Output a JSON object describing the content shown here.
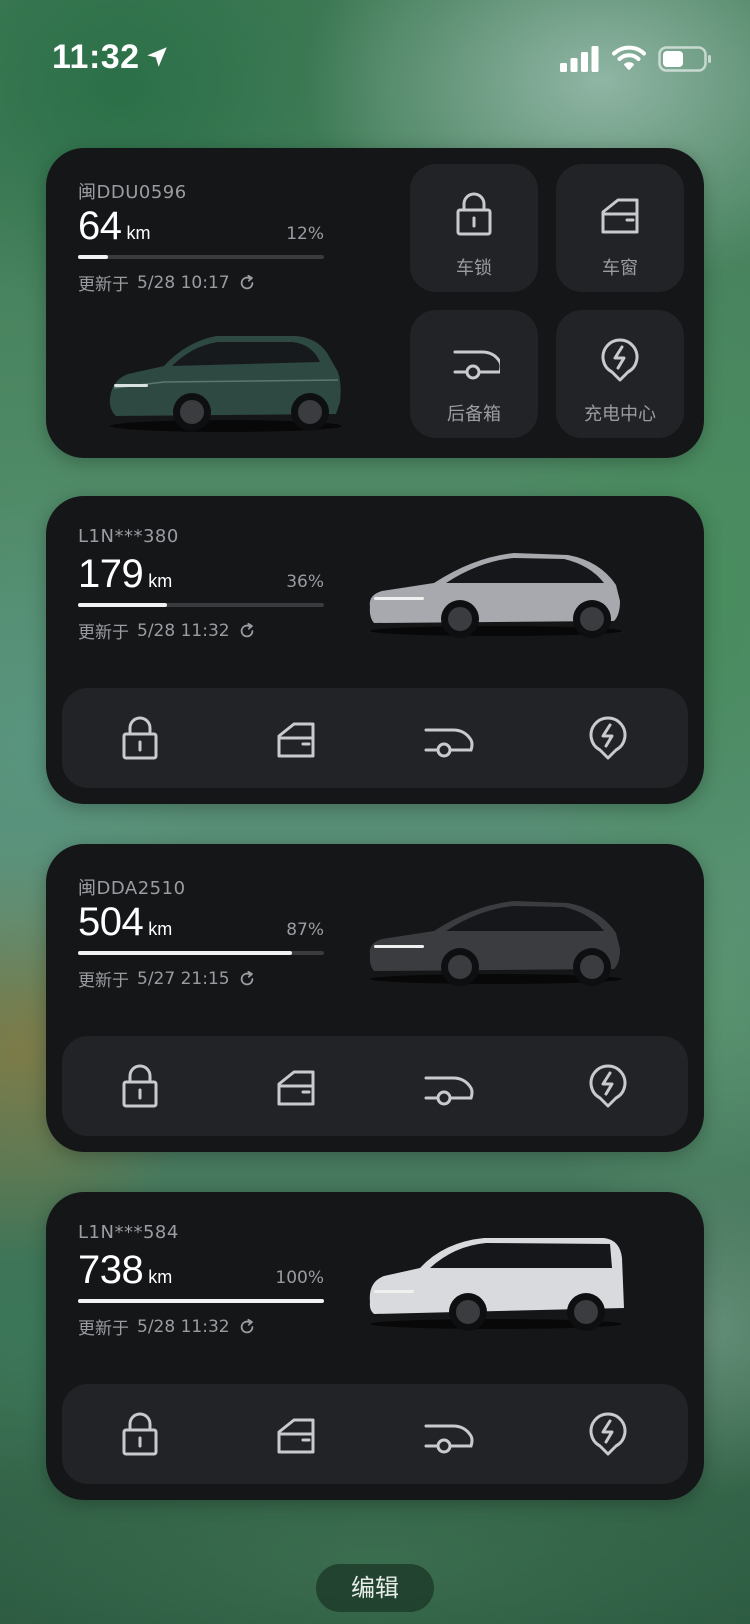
{
  "status_bar": {
    "time": "11:32",
    "icons": [
      "location-arrow-icon",
      "cellular-signal-icon",
      "wifi-icon",
      "battery-icon"
    ]
  },
  "cards": [
    {
      "plate": "闽DDU0596",
      "range": "64",
      "unit": "km",
      "percent": "12%",
      "charge_fraction": 0.12,
      "updated_label": "更新于",
      "updated_time": "5/28 10:17",
      "car_color": "#2f4a44",
      "actions": [
        {
          "label": "车锁",
          "icon": "lock-icon"
        },
        {
          "label": "车窗",
          "icon": "window-icon"
        },
        {
          "label": "后备箱",
          "icon": "trunk-icon"
        },
        {
          "label": "充电中心",
          "icon": "charging-icon"
        }
      ]
    },
    {
      "plate": "L1N***380",
      "range": "179",
      "unit": "km",
      "percent": "36%",
      "charge_fraction": 0.36,
      "updated_label": "更新于",
      "updated_time": "5/28 11:32",
      "car_color": "#a8a9ae",
      "actions": [
        {
          "icon": "lock-icon"
        },
        {
          "icon": "window-icon"
        },
        {
          "icon": "trunk-icon"
        },
        {
          "icon": "charging-icon"
        }
      ]
    },
    {
      "plate": "闽DDA2510",
      "range": "504",
      "unit": "km",
      "percent": "87%",
      "charge_fraction": 0.87,
      "updated_label": "更新于",
      "updated_time": "5/27 21:15",
      "car_color": "#3b3c40",
      "actions": [
        {
          "icon": "lock-icon"
        },
        {
          "icon": "window-icon"
        },
        {
          "icon": "trunk-icon"
        },
        {
          "icon": "charging-icon"
        }
      ]
    },
    {
      "plate": "L1N***584",
      "range": "738",
      "unit": "km",
      "percent": "100%",
      "charge_fraction": 1.0,
      "updated_label": "更新于",
      "updated_time": "5/28 11:32",
      "car_color": "#d9dadd",
      "actions": [
        {
          "icon": "lock-icon"
        },
        {
          "icon": "window-icon"
        },
        {
          "icon": "trunk-icon"
        },
        {
          "icon": "charging-icon"
        }
      ]
    }
  ],
  "edit_button": "编辑"
}
